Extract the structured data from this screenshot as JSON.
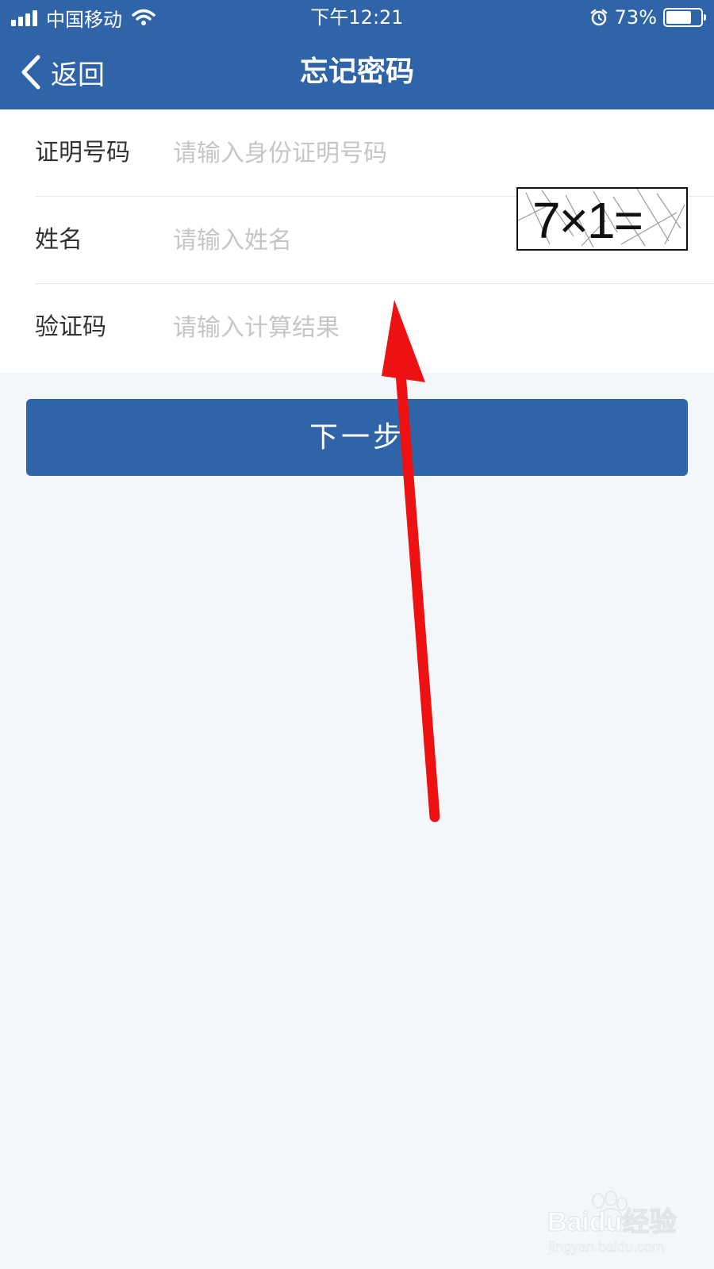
{
  "status_bar": {
    "carrier": "中国移动",
    "time": "下午12:21",
    "battery_percent": "73%",
    "battery_level": 0.73
  },
  "nav": {
    "back_label": "返回",
    "title": "忘记密码"
  },
  "form": {
    "id_number": {
      "label": "证明号码",
      "placeholder": "请输入身份证明号码",
      "value": ""
    },
    "name": {
      "label": "姓名",
      "placeholder": "请输入姓名",
      "value": ""
    },
    "captcha": {
      "label": "验证码",
      "placeholder": "请输入计算结果",
      "value": "",
      "image_text": "7×1="
    }
  },
  "next_button": {
    "label": "下一步"
  },
  "watermark": {
    "brand": "Baidu经验",
    "url": "jingyan.baidu.com"
  },
  "colors": {
    "primary": "#2f65a8",
    "background": "#f4f7f9",
    "annotation_arrow": "#ee1111"
  }
}
